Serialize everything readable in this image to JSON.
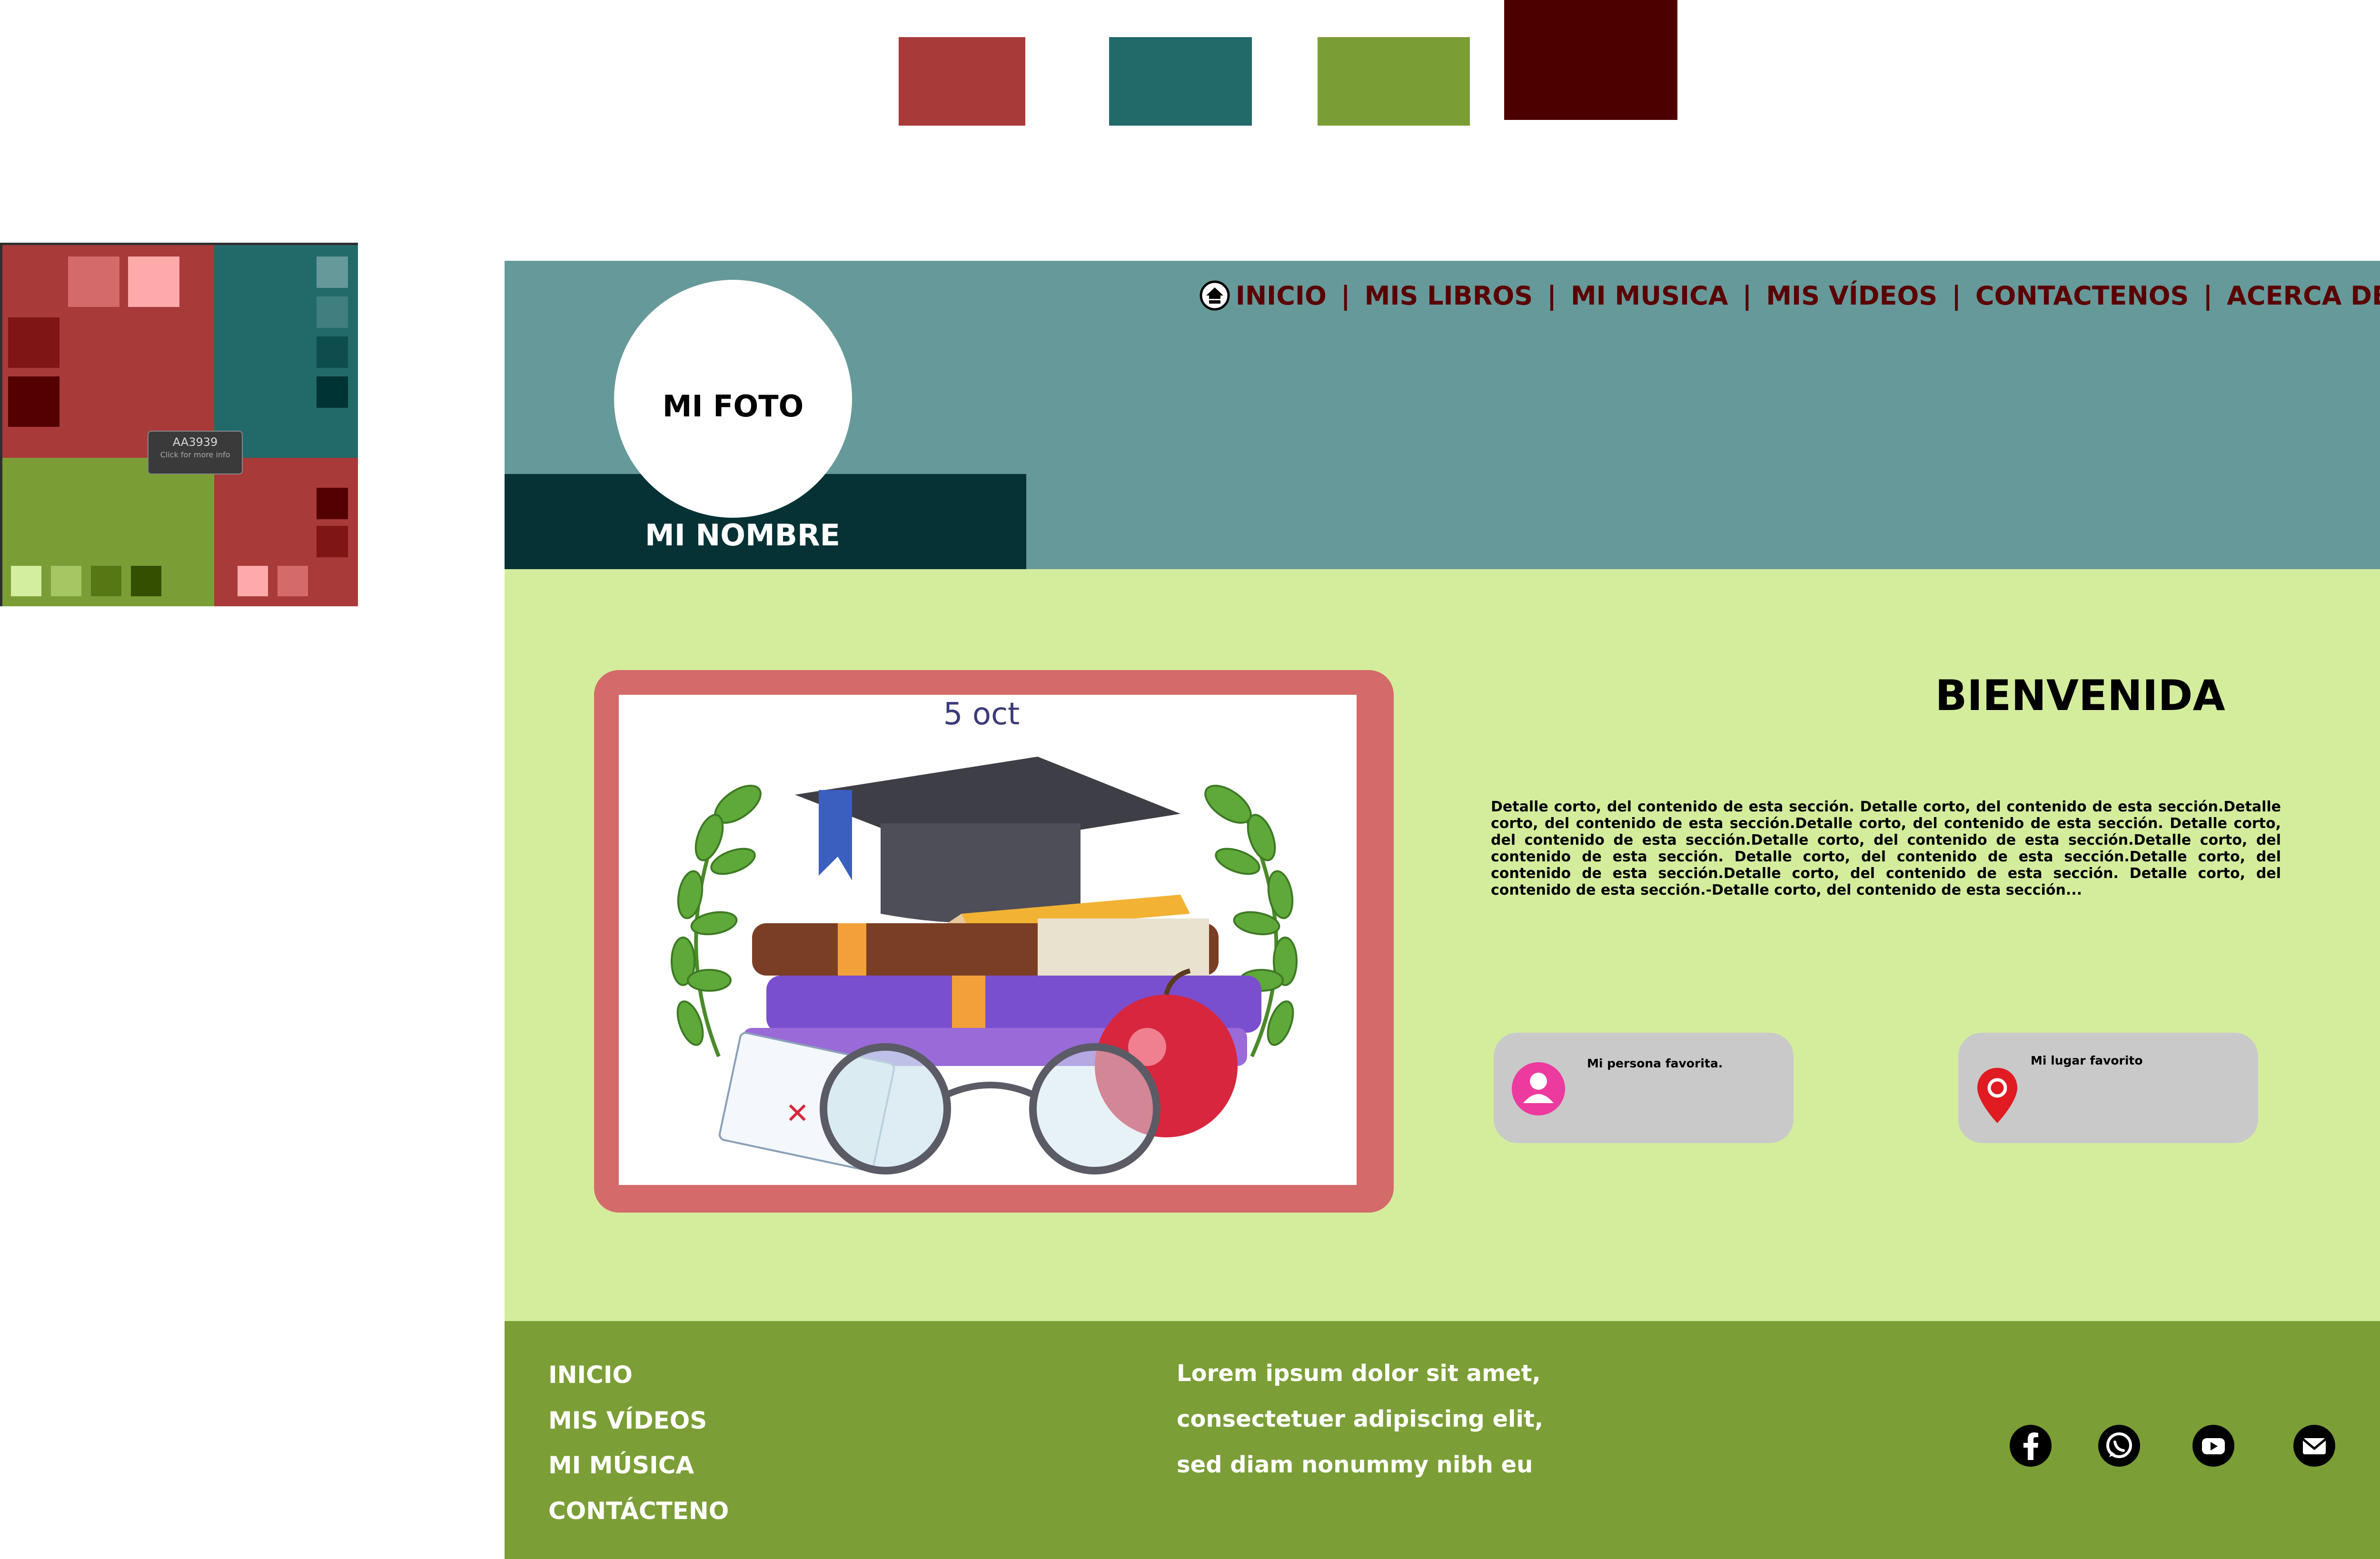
{
  "colors": {
    "red": "#a83a3a",
    "teal": "#22696a",
    "green": "#7a9e35",
    "maroon": "#4d0000",
    "header_bg": "#66999a",
    "name_bar": "#063236",
    "main_bg": "#d4ed9d",
    "frame": "#d46a6a",
    "footer_bg": "#7b9e36",
    "card_bg": "#c9c9c9"
  },
  "palette": {
    "tooltip_title": "AA3939",
    "tooltip_sub": "Click for more info"
  },
  "header": {
    "nav": [
      "INICIO",
      "MIS LIBROS",
      "MI MUSICA",
      "MIS VÍDEOS",
      "CONTACTENOS",
      "ACERCA DE"
    ],
    "nav_separator": "|",
    "photo_label": "MI FOTO",
    "name_label": "MI NOMBRE"
  },
  "main": {
    "image_caption": "5 oct",
    "title": "BIENVENIDA",
    "body": "Detalle corto, del contenido de esta sección. Detalle corto, del contenido de esta sección.Detalle corto, del contenido de esta sección.Detalle corto, del contenido de esta sección. Detalle corto, del contenido de esta sección.Detalle corto, del contenido de esta sección.Detalle corto, del contenido de esta sección. Detalle corto, del contenido de esta sección.Detalle corto, del contenido de esta sección.Detalle corto, del contenido de esta sección. Detalle corto, del contenido de esta sección.-Detalle corto, del contenido de esta sección...",
    "cards": [
      {
        "label": "Mi persona favorita.",
        "icon": "person-icon"
      },
      {
        "label": "Mi lugar favorito",
        "icon": "location-pin-icon"
      }
    ]
  },
  "footer": {
    "links": [
      "INICIO",
      "MIS VÍDEOS",
      "MI MÚSICA",
      "CONTÁCTENO"
    ],
    "text_lines": [
      "Lorem ipsum dolor sit amet,",
      "consectetuer adipiscing elit,",
      "sed diam nonummy nibh eu"
    ],
    "social_icons": [
      "facebook-icon",
      "whatsapp-icon",
      "youtube-icon",
      "email-icon"
    ]
  }
}
